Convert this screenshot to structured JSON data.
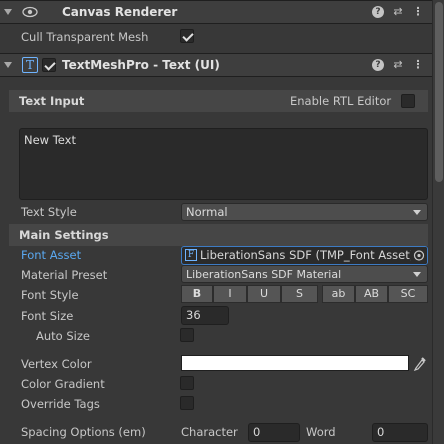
{
  "canvas_renderer": {
    "title": "Canvas Renderer",
    "cull_label": "Cull Transparent Mesh",
    "cull_checked": true
  },
  "tmp": {
    "title": "TextMeshPro - Text (UI)",
    "enabled": true
  },
  "text_input": {
    "title": "Text Input",
    "rtl_label": "Enable RTL Editor",
    "text_value": "New Text",
    "style_label": "Text Style",
    "style_value": "Normal"
  },
  "main_settings": {
    "title": "Main Settings",
    "font_asset_label": "Font Asset",
    "font_asset_value": "LiberationSans SDF (TMP_Font Asset)",
    "material_label": "Material Preset",
    "material_value": "LiberationSans SDF Material",
    "font_style_label": "Font Style",
    "font_style_buttons": [
      "B",
      "I",
      "U",
      "S",
      "ab",
      "AB",
      "SC"
    ],
    "font_size_label": "Font Size",
    "font_size_value": "36",
    "auto_size_label": "Auto Size",
    "vertex_color_label": "Vertex Color",
    "vertex_color": "#ffffff",
    "gradient_label": "Color Gradient",
    "override_label": "Override Tags",
    "spacing_label": "Spacing Options (em)",
    "character_label": "Character",
    "character_value": "0",
    "word_label": "Word",
    "word_value": "0"
  },
  "colors": {
    "accent_label": "#4aa3ff"
  }
}
